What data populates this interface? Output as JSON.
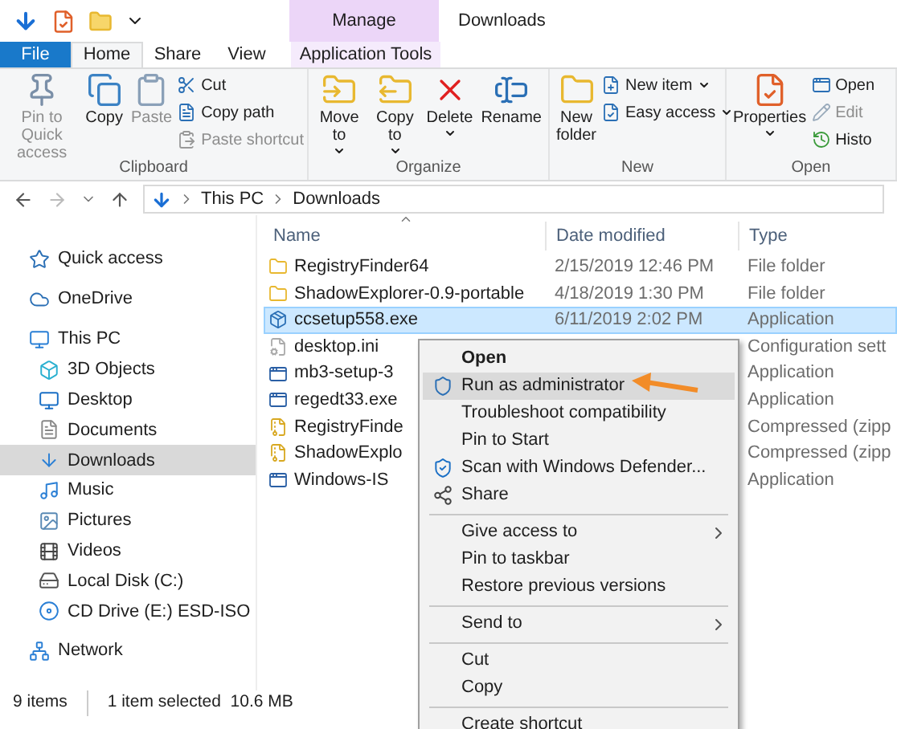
{
  "window": {
    "title": "Downloads"
  },
  "ribbon": {
    "context_label": "Manage",
    "tabs": [
      {
        "label": "File",
        "kind": "file",
        "selected": false
      },
      {
        "label": "Home",
        "kind": "tab",
        "selected": true
      },
      {
        "label": "Share",
        "kind": "tab",
        "selected": false
      },
      {
        "label": "View",
        "kind": "tab",
        "selected": false
      },
      {
        "label": "Application Tools",
        "kind": "contextual",
        "selected": false
      }
    ],
    "groups": [
      {
        "label": "Clipboard",
        "large": [
          {
            "label": "Pin to Quick access",
            "disabled": true
          },
          {
            "label": "Copy",
            "disabled": false
          },
          {
            "label": "Paste",
            "disabled": true
          }
        ],
        "small": [
          {
            "label": "Cut",
            "disabled": false
          },
          {
            "label": "Copy path",
            "disabled": false
          },
          {
            "label": "Paste shortcut",
            "disabled": true
          }
        ]
      },
      {
        "label": "Organize",
        "large": [
          {
            "label": "Move to",
            "disabled": false,
            "dropdown": true
          },
          {
            "label": "Copy to",
            "disabled": false,
            "dropdown": true
          },
          {
            "label": "Delete",
            "disabled": false,
            "dropdown": true
          },
          {
            "label": "Rename",
            "disabled": false
          }
        ]
      },
      {
        "label": "New",
        "large": [
          {
            "label": "New folder",
            "disabled": false
          }
        ],
        "small": [
          {
            "label": "New item",
            "disabled": false,
            "dropdown": true
          },
          {
            "label": "Easy access",
            "disabled": false,
            "dropdown": true
          }
        ]
      },
      {
        "label": "Open",
        "large": [
          {
            "label": "Properties",
            "disabled": false,
            "dropdown": true
          }
        ],
        "small": [
          {
            "label": "Open",
            "disabled": false
          },
          {
            "label": "Edit",
            "disabled": true
          },
          {
            "label": "Histo",
            "disabled": false
          }
        ]
      }
    ]
  },
  "address": {
    "path": [
      "This PC",
      "Downloads"
    ]
  },
  "sidebar": {
    "items": [
      {
        "label": "Quick access",
        "selected": false
      },
      {
        "label": "OneDrive",
        "selected": false
      },
      {
        "label": "This PC",
        "selected": false,
        "children": [
          {
            "label": "3D Objects",
            "selected": false
          },
          {
            "label": "Desktop",
            "selected": false
          },
          {
            "label": "Documents",
            "selected": false
          },
          {
            "label": "Downloads",
            "selected": true
          },
          {
            "label": "Music",
            "selected": false
          },
          {
            "label": "Pictures",
            "selected": false
          },
          {
            "label": "Videos",
            "selected": false
          },
          {
            "label": "Local Disk (C:)",
            "selected": false
          },
          {
            "label": "CD Drive (E:) ESD-ISO",
            "selected": false
          }
        ]
      },
      {
        "label": "Network",
        "selected": false
      }
    ]
  },
  "table": {
    "columns": [
      "Name",
      "Date modified",
      "Type"
    ],
    "rows": [
      {
        "kind": "folder",
        "name": "RegistryFinder64",
        "date": "2/15/2019 12:46 PM",
        "type": "File folder",
        "selected": false
      },
      {
        "kind": "folder",
        "name": "ShadowExplorer-0.9-portable",
        "date": "4/18/2019 1:30 PM",
        "type": "File folder",
        "selected": false
      },
      {
        "kind": "setup",
        "name": "ccsetup558.exe",
        "date": "6/11/2019 2:02 PM",
        "type": "Application",
        "selected": true
      },
      {
        "kind": "config",
        "name": "desktop.ini",
        "type": "Configuration sett",
        "selected": false
      },
      {
        "kind": "app",
        "name": "mb3-setup-3",
        "type": "Application",
        "selected": false
      },
      {
        "kind": "app",
        "name": "regedt33.exe",
        "type": "Application",
        "selected": false
      },
      {
        "kind": "zip",
        "name": "RegistryFinde",
        "type": "Compressed (zipp",
        "selected": false
      },
      {
        "kind": "zip",
        "name": "ShadowExplo",
        "type": "Compressed (zipp",
        "selected": false
      },
      {
        "kind": "app",
        "name": "Windows-IS",
        "type": "Application",
        "selected": false
      }
    ]
  },
  "context_menu": {
    "items": [
      {
        "kind": "item",
        "label": "Open",
        "default": true,
        "selected": false,
        "submenu": false
      },
      {
        "kind": "item",
        "label": "Run as administrator",
        "default": false,
        "selected": true,
        "submenu": false
      },
      {
        "kind": "item",
        "label": "Troubleshoot compatibility",
        "default": false,
        "selected": false,
        "submenu": false
      },
      {
        "kind": "item",
        "label": "Pin to Start",
        "default": false,
        "selected": false,
        "submenu": false
      },
      {
        "kind": "item",
        "label": "Scan with Windows Defender...",
        "default": false,
        "selected": false,
        "submenu": false
      },
      {
        "kind": "item",
        "label": "Share",
        "default": false,
        "selected": false,
        "submenu": false
      },
      {
        "kind": "separator"
      },
      {
        "kind": "item",
        "label": "Give access to",
        "default": false,
        "selected": false,
        "submenu": true
      },
      {
        "kind": "item",
        "label": "Pin to taskbar",
        "default": false,
        "selected": false,
        "submenu": false
      },
      {
        "kind": "item",
        "label": "Restore previous versions",
        "default": false,
        "selected": false,
        "submenu": false
      },
      {
        "kind": "separator"
      },
      {
        "kind": "item",
        "label": "Send to",
        "default": false,
        "selected": false,
        "submenu": true
      },
      {
        "kind": "separator"
      },
      {
        "kind": "item",
        "label": "Cut",
        "default": false,
        "selected": false,
        "submenu": false
      },
      {
        "kind": "item",
        "label": "Copy",
        "default": false,
        "selected": false,
        "submenu": false
      },
      {
        "kind": "separator"
      },
      {
        "kind": "item",
        "label": "Create shortcut",
        "default": false,
        "selected": false,
        "submenu": false
      }
    ]
  },
  "status_bar": {
    "items": [
      "9 items",
      "1 item selected  10.6 MB"
    ]
  }
}
